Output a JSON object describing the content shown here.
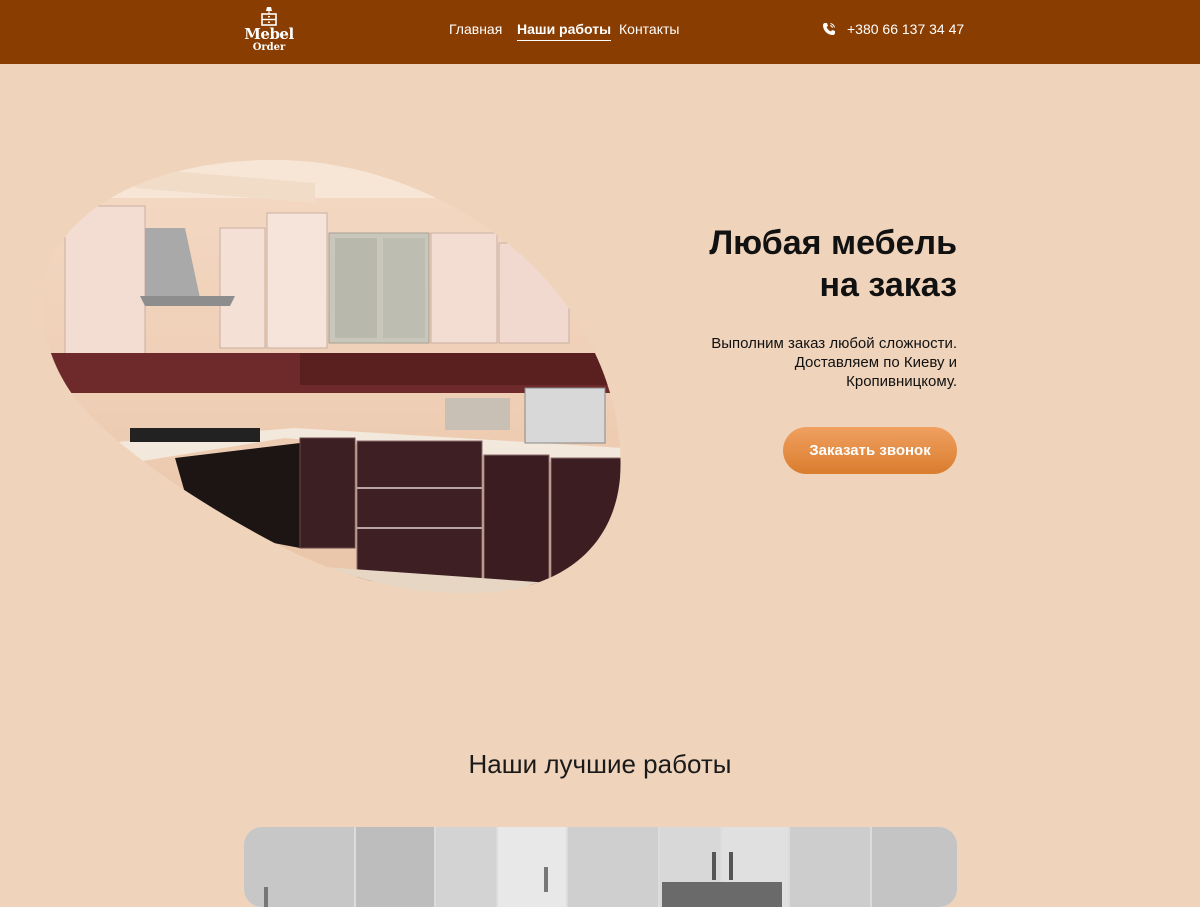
{
  "brand": {
    "logo_line1": "Mebel",
    "logo_line2": "Order"
  },
  "nav": {
    "items": [
      {
        "label": "Главная",
        "active": false
      },
      {
        "label": "Наши работы",
        "active": true
      },
      {
        "label": "Контакты",
        "active": false
      }
    ]
  },
  "contact": {
    "phone": "+380 66 137 34 47",
    "icon": "phone-icon"
  },
  "hero": {
    "title_line1": "Любая мебель",
    "title_line2": "на заказ",
    "description": "Выполним заказ любой сложности. Доставляем по Киеву и Кропивницкому.",
    "cta_label": "Заказать звонок",
    "image": "kitchen-photo"
  },
  "works": {
    "title": "Наши лучшие работы",
    "image": "kitchen-gallery-photo"
  },
  "colors": {
    "header_bg": "#8a3d00",
    "page_bg": "#efd3bb",
    "cta_gradient_top": "#f0a060",
    "cta_gradient_bottom": "#d97d2e"
  }
}
